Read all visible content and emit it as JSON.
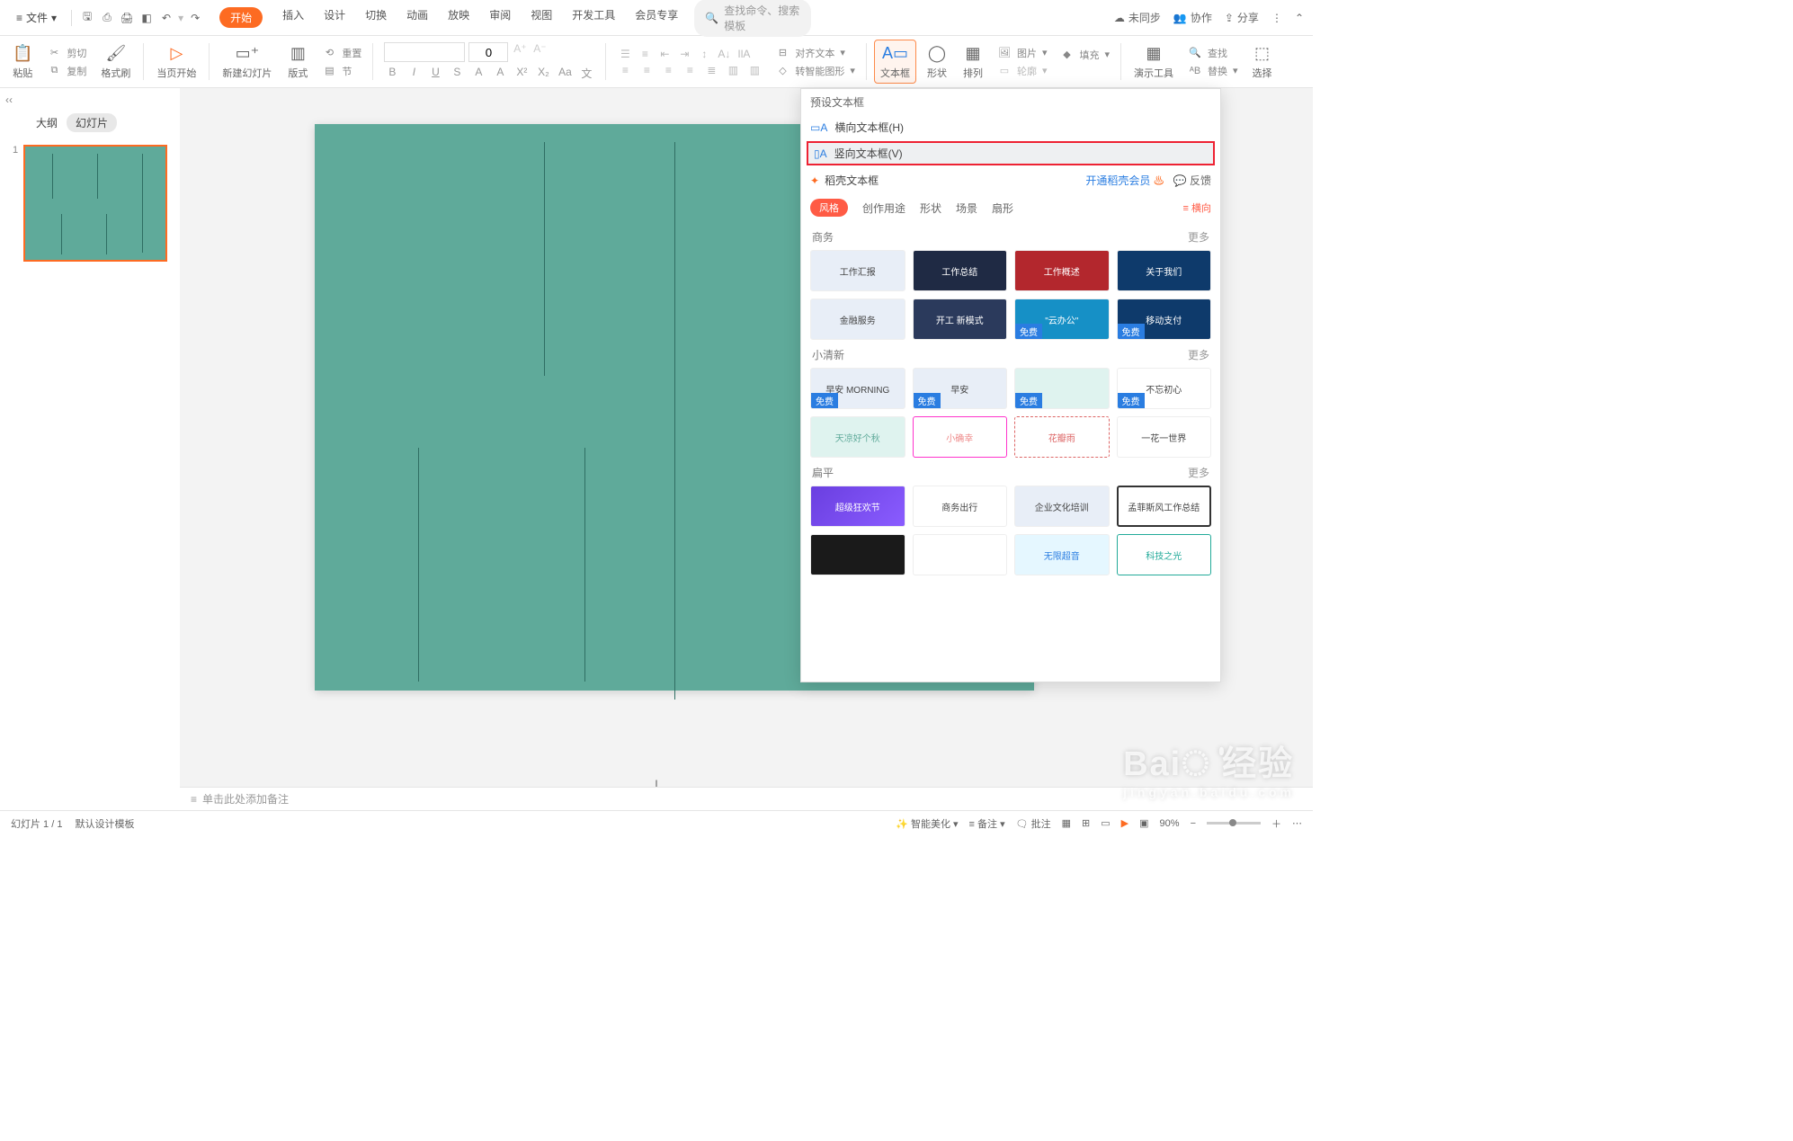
{
  "menubar": {
    "file": "文件",
    "tabs": [
      "开始",
      "插入",
      "设计",
      "切换",
      "动画",
      "放映",
      "审阅",
      "视图",
      "开发工具",
      "会员专享"
    ],
    "search_placeholder": "查找命令、搜索模板",
    "right": {
      "unsync": "未同步",
      "collab": "协作",
      "share": "分享"
    }
  },
  "ribbon": {
    "paste": "粘贴",
    "cut": "剪切",
    "copy": "复制",
    "format_painter": "格式刷",
    "from_current": "当页开始",
    "new_slide": "新建幻灯片",
    "layout": "版式",
    "section": "节",
    "reset": "重置",
    "font_name": "",
    "font_size": "0",
    "align_text": "对齐文本",
    "convert_smart": "转智能图形",
    "textbox": "文本框",
    "shape": "形状",
    "arrange": "排列",
    "picture": "图片",
    "fill": "填充",
    "outline": "轮廓",
    "tools": "演示工具",
    "replace": "替换",
    "find": "查找",
    "select": "选择"
  },
  "sidepanel": {
    "outline": "大纲",
    "slides": "幻灯片",
    "thumb_index": "1"
  },
  "notes_placeholder": "单击此处添加备注",
  "dropdown": {
    "preset_header": "预设文本框",
    "horizontal": "横向文本框(H)",
    "vertical": "竖向文本框(V)",
    "docu_textbox": "稻壳文本框",
    "open_member": "开通稻壳会员",
    "feedback": "反馈",
    "filters": {
      "style": "风格",
      "purpose": "创作用途",
      "shape": "形状",
      "scene": "场景",
      "fan": "扇形",
      "orient": "横向"
    },
    "sections": [
      {
        "title": "商务",
        "more": "更多",
        "cards": [
          {
            "cls": "c4",
            "t": "工作汇报"
          },
          {
            "cls": "c1",
            "t": "工作总结"
          },
          {
            "cls": "c2",
            "t": "工作概述"
          },
          {
            "cls": "c3",
            "t": "关于我们"
          },
          {
            "cls": "c4",
            "t": "金融服务"
          },
          {
            "cls": "c5",
            "t": "开工 新模式"
          },
          {
            "cls": "c6",
            "t": "\"云办公\"",
            "badge": "免费"
          },
          {
            "cls": "c3",
            "t": "移动支付",
            "badge": "免费"
          }
        ]
      },
      {
        "title": "小清新",
        "more": "更多",
        "cards": [
          {
            "cls": "c4",
            "t": "早安 MORNING",
            "badge": "免费"
          },
          {
            "cls": "c4",
            "t": "早安",
            "badge": "免费"
          },
          {
            "cls": "c7",
            "t": "",
            "badge": "免费"
          },
          {
            "cls": "c10",
            "t": "不忘初心",
            "badge": "免费"
          },
          {
            "cls": "c7",
            "t": "天凉好个秋"
          },
          {
            "cls": "c8",
            "t": "小确幸"
          },
          {
            "cls": "c9",
            "t": "花瓣雨"
          },
          {
            "cls": "c10",
            "t": "一花一世界"
          }
        ]
      },
      {
        "title": "扁平",
        "more": "更多",
        "cards": [
          {
            "cls": "c11",
            "t": "超级狂欢节"
          },
          {
            "cls": "c12",
            "t": "商务出行"
          },
          {
            "cls": "c4",
            "t": "企业文化培训"
          },
          {
            "cls": "c13",
            "t": "孟菲斯风工作总结"
          },
          {
            "cls": "c16",
            "t": ""
          },
          {
            "cls": "c10",
            "t": ""
          },
          {
            "cls": "c14",
            "t": "无限超音"
          },
          {
            "cls": "c15",
            "t": "科技之光"
          }
        ]
      }
    ]
  },
  "statusbar": {
    "slide_count": "幻灯片 1 / 1",
    "template": "默认设计模板",
    "beautify": "智能美化",
    "notes": "备注",
    "comment": "批注",
    "zoom": "90%"
  },
  "watermark": {
    "brand": "Baiൎ 经验",
    "sub": "jingyan.baidu.com"
  }
}
